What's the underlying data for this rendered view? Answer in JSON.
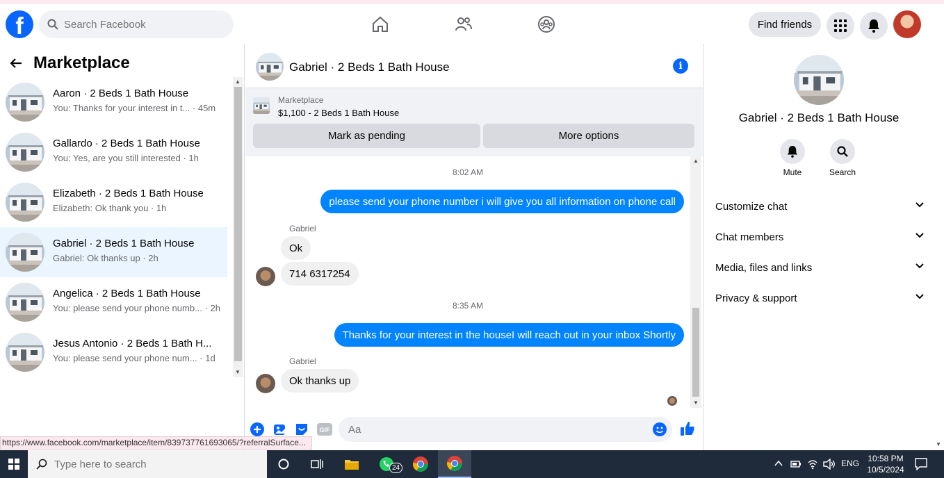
{
  "topbar": {
    "logo": "f",
    "search_placeholder": "Search Facebook",
    "find_friends": "Find friends"
  },
  "sidebar": {
    "title": "Marketplace",
    "conversations": [
      {
        "title": "Aaron · 2 Beds 1 Bath House",
        "preview": "You: Thanks for your interest in t...",
        "time": "· 45m"
      },
      {
        "title": "Gallardo · 2 Beds 1 Bath House",
        "preview": "You: Yes, are you still interested",
        "time": "· 1h"
      },
      {
        "title": "Elizabeth · 2 Beds 1 Bath House",
        "preview": "Elizabeth: Ok thank you",
        "time": "· 1h"
      },
      {
        "title": "Gabriel · 2 Beds 1 Bath House",
        "preview": "Gabriel: Ok thanks up",
        "time": "· 2h"
      },
      {
        "title": "Angelica · 2 Beds 1 Bath House",
        "preview": "You: please send your phone numb...",
        "time": "· 2h"
      },
      {
        "title": "Jesus Antonio · 2 Beds 1 Bath H...",
        "preview": "You: please send your phone num...",
        "time": "· 1d"
      }
    ]
  },
  "chat": {
    "title": "Gabriel · 2 Beds 1 Bath House",
    "listing_label": "Marketplace",
    "listing_price": "$1,100 - 2 Beds 1 Bath House",
    "mark_pending": "Mark as pending",
    "more_options": "More options",
    "ts1": "8:02 AM",
    "msg1": "please send your phone number i will give you all information on phone call",
    "sender1": "Gabriel",
    "msg2": "Ok",
    "msg3": "714 6317254",
    "ts2": "8:35 AM",
    "msg4": "Thanks for your interest in the houseI will reach out in your inbox Shortly",
    "sender2": "Gabriel",
    "msg5": "Ok thanks up",
    "composer_placeholder": "Aa"
  },
  "details": {
    "title": "Gabriel · 2 Beds 1 Bath House",
    "mute": "Mute",
    "search": "Search",
    "sections": [
      "Customize chat",
      "Chat members",
      "Media, files and links",
      "Privacy & support"
    ]
  },
  "status_url": "https://www.facebook.com/marketplace/item/839737761693065/?referralSurface...",
  "taskbar": {
    "search_placeholder": "Type here to search",
    "whatsapp_badge": "24",
    "lang": "ENG",
    "time": "10:58 PM",
    "date": "10/5/2024"
  },
  "colors": {
    "brand": "#0866ff",
    "bubble_out": "#0084ff",
    "active_row": "#ebf5ff"
  }
}
